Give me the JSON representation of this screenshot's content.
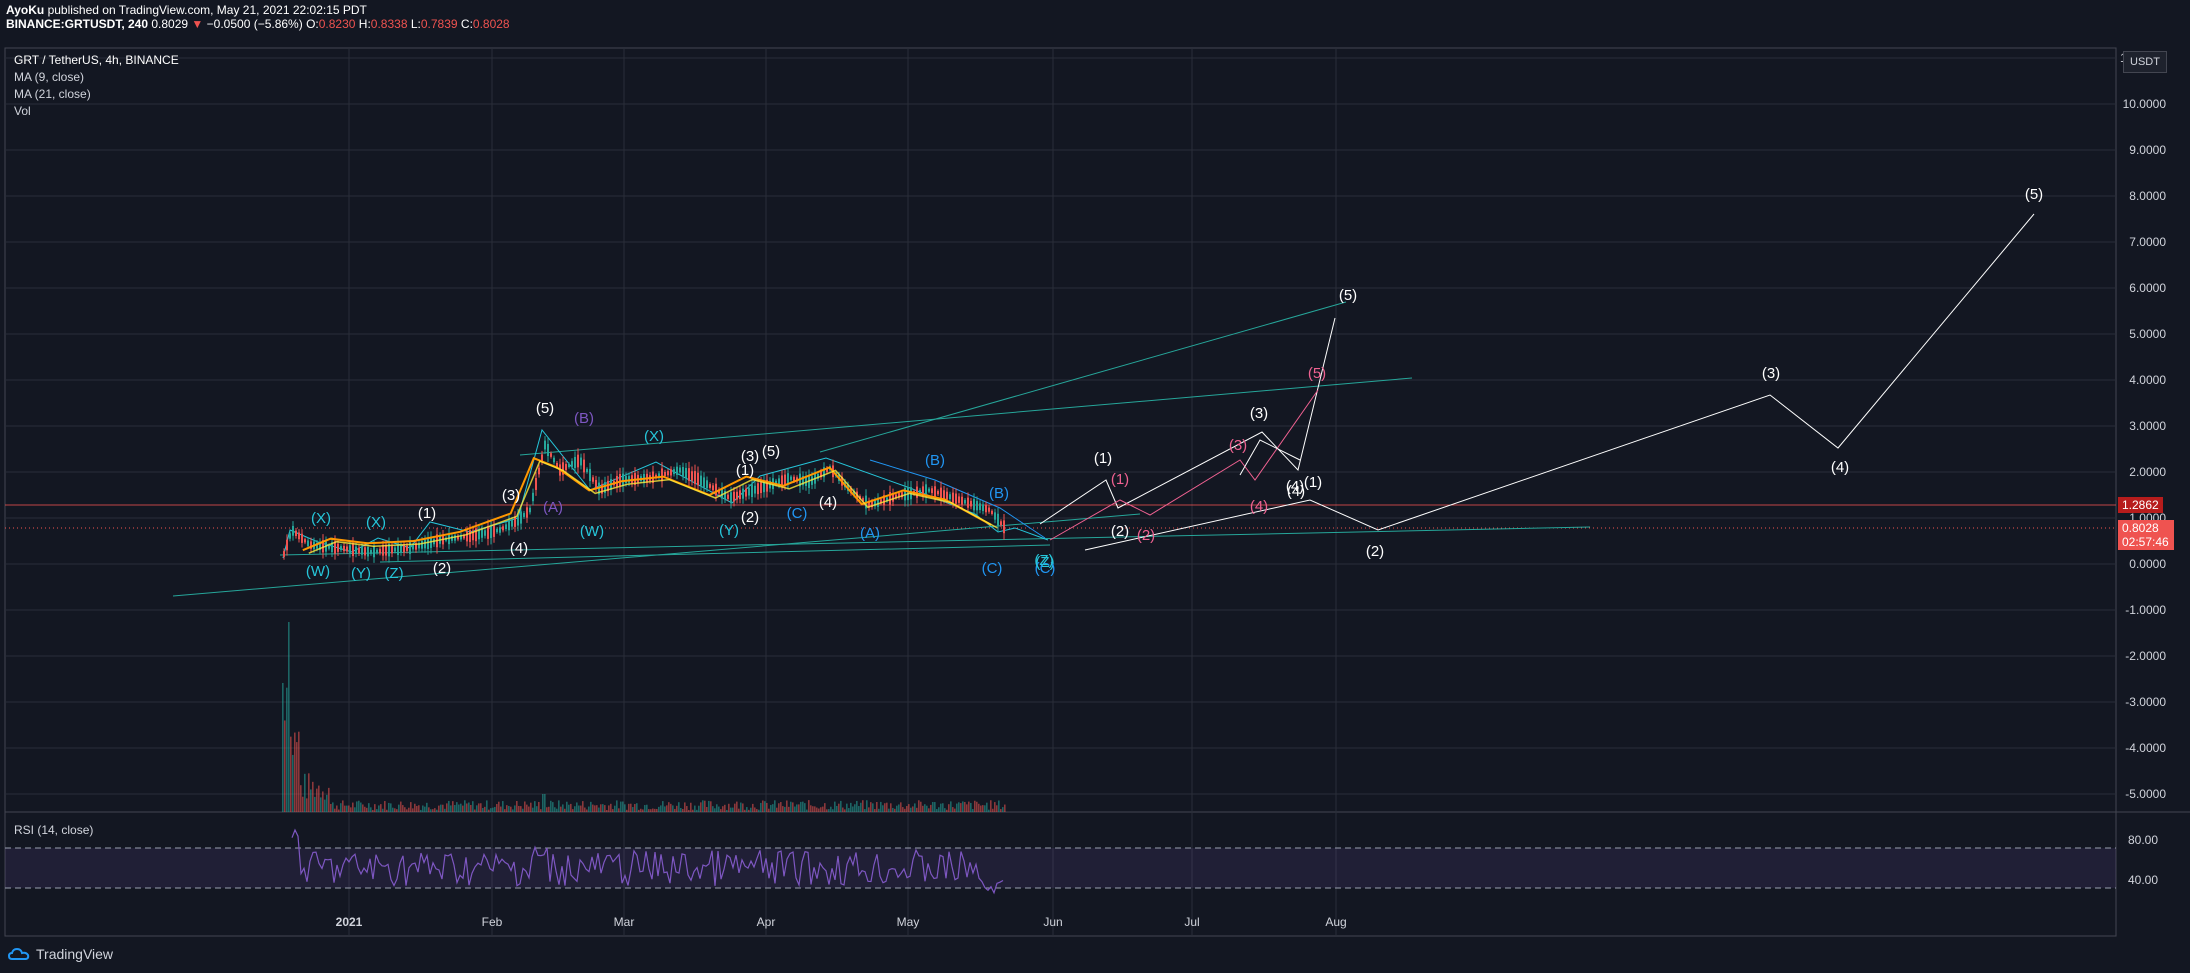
{
  "header": {
    "author": "AyoKu",
    "published": "published on TradingView.com, May 21, 2021 22:02:15 PDT",
    "symbol_line": "BINANCE:GRTUSDT, 240",
    "last": "0.8029",
    "change_arrow": "▼",
    "change": "−0.0500 (−5.86%)",
    "o_label": "O:",
    "o_val": "0.8230",
    "h_label": "H:",
    "h_val": "0.8338",
    "l_label": "L:",
    "l_val": "0.7839",
    "c_label": "C:",
    "c_val": "0.8028"
  },
  "legend": {
    "title": "GRT / TetherUS, 4h, BINANCE",
    "ma9": "MA (9, close)",
    "ma21": "MA (21, close)",
    "vol": "Vol",
    "rsi": "RSI (14, close)"
  },
  "price_axis": {
    "unit": "USDT",
    "ticks": [
      "1.0000",
      "10.0000",
      "9.0000",
      "8.0000",
      "7.0000",
      "6.0000",
      "5.0000",
      "4.0000",
      "3.0000",
      "2.0000",
      "1.0000",
      "0.0000",
      "-1.0000",
      "-2.0000",
      "-3.0000",
      "-4.0000",
      "-5.0000"
    ],
    "tick_values": [
      11,
      10,
      9,
      8,
      7,
      6,
      5,
      4,
      3,
      2,
      1,
      0,
      -1,
      -2,
      -3,
      -4,
      -5
    ],
    "red_tag": "1.2862",
    "price_tag": "0.8028",
    "countdown": "02:57:46"
  },
  "rsi_axis": {
    "ticks": [
      "80.00",
      "40.00"
    ]
  },
  "time_axis": {
    "labels": [
      "2021",
      "Feb",
      "Mar",
      "Apr",
      "May",
      "Jun",
      "Jul",
      "Aug"
    ]
  },
  "footer": {
    "brand": "TradingView"
  },
  "colors": {
    "bg": "#131722",
    "grid": "#2a2e39",
    "cyan": "#26c6da",
    "white": "#ffffff",
    "pink": "#f06292",
    "blue": "#2196f3",
    "purple": "#7e57c2",
    "orange": "#ff9800",
    "teal": "#26a69a"
  },
  "chart_data": {
    "type": "line",
    "title": "GRT / TetherUS, 4h, BINANCE",
    "ylim": [
      -5.5,
      11
    ],
    "y_unit": "USDT",
    "series": [
      {
        "name": "MA (9, close)",
        "x": [
          "2020-12-22",
          "2020-12-28",
          "2021-01-05",
          "2021-01-15",
          "2021-01-25",
          "2021-02-05",
          "2021-02-10",
          "2021-02-15",
          "2021-02-22",
          "2021-03-01",
          "2021-03-10",
          "2021-03-20",
          "2021-03-28",
          "2021-04-05",
          "2021-04-15",
          "2021-04-22",
          "2021-05-01",
          "2021-05-10",
          "2021-05-20"
        ],
        "values": [
          0.3,
          0.55,
          0.45,
          0.5,
          0.7,
          1.1,
          2.3,
          2.1,
          1.6,
          1.8,
          1.9,
          1.5,
          1.9,
          1.7,
          2.1,
          1.3,
          1.6,
          1.4,
          0.85
        ]
      }
    ],
    "annotations": [
      "(X)",
      "(W)",
      "(X)",
      "(Y)",
      "(Z)",
      "(1)",
      "(2)",
      "(3)",
      "(4)",
      "(5)",
      "(B)",
      "(A)",
      "(W)",
      "(X)",
      "(Y)",
      "(Z)",
      "(1)",
      "(2)",
      "(3)",
      "(4)",
      "(5)",
      "(A)",
      "(B)",
      "(C)",
      "(B)",
      "(4)",
      "(C)",
      "(Z)",
      "(C)",
      "(1)",
      "(2)",
      "(3)",
      "(4)",
      "(5)",
      "(1)",
      "(2)",
      "(3)",
      "(4)",
      "(5)",
      "(1)",
      "(2)",
      "(3)",
      "(4)",
      "(5)"
    ]
  }
}
